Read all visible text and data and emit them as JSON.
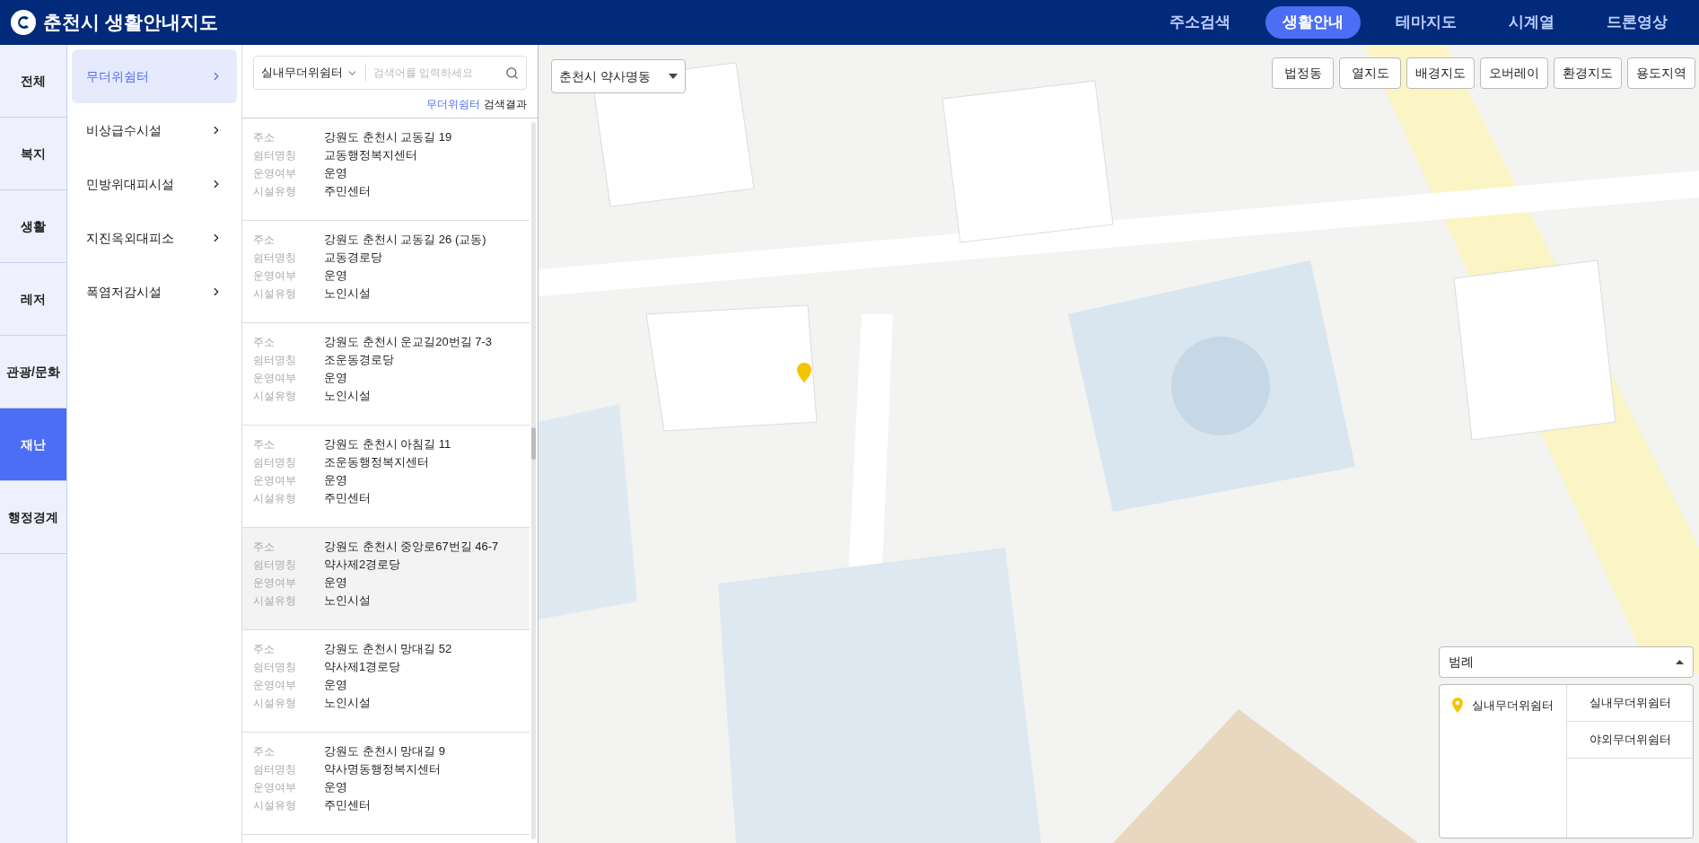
{
  "header": {
    "title": "춘천시 생활안내지도",
    "nav": [
      {
        "label": "주소검색",
        "selected": false
      },
      {
        "label": "생활안내",
        "selected": true
      },
      {
        "label": "테마지도",
        "selected": false
      },
      {
        "label": "시계열",
        "selected": false
      },
      {
        "label": "드론영상",
        "selected": false
      }
    ]
  },
  "categories": [
    {
      "label": "전체",
      "selected": false
    },
    {
      "label": "복지",
      "selected": false
    },
    {
      "label": "생활",
      "selected": false
    },
    {
      "label": "레저",
      "selected": false
    },
    {
      "label": "관광/문화",
      "selected": false
    },
    {
      "label": "재난",
      "selected": true
    },
    {
      "label": "행정경계",
      "selected": false
    }
  ],
  "subcategories": [
    {
      "label": "무더위쉼터",
      "selected": true
    },
    {
      "label": "비상급수시설",
      "selected": false
    },
    {
      "label": "민방위대피시설",
      "selected": false
    },
    {
      "label": "지진옥외대피소",
      "selected": false
    },
    {
      "label": "폭염저감시설",
      "selected": false
    }
  ],
  "search": {
    "filter": "실내무더위쉼터",
    "placeholder": "검색어를 입력하세요",
    "result_keyword": "무더위쉼터",
    "result_suffix": "검색결과"
  },
  "results": [
    {
      "selected": false,
      "fields": [
        {
          "label": "주소",
          "value": "강원도 춘천시 교동길 19"
        },
        {
          "label": "쉼터명칭",
          "value": "교동행정복지센터"
        },
        {
          "label": "운영여부",
          "value": "운영"
        },
        {
          "label": "시설유형",
          "value": "주민센터"
        }
      ]
    },
    {
      "selected": false,
      "fields": [
        {
          "label": "주소",
          "value": "강원도 춘천시 교동길 26 (교동)"
        },
        {
          "label": "쉼터명칭",
          "value": "교동경로당"
        },
        {
          "label": "운영여부",
          "value": "운영"
        },
        {
          "label": "시설유형",
          "value": "노인시설"
        }
      ]
    },
    {
      "selected": false,
      "fields": [
        {
          "label": "주소",
          "value": "강원도 춘천시 운교길20번길 7-3"
        },
        {
          "label": "쉼터명칭",
          "value": "조운동경로당"
        },
        {
          "label": "운영여부",
          "value": "운영"
        },
        {
          "label": "시설유형",
          "value": "노인시설"
        }
      ]
    },
    {
      "selected": false,
      "fields": [
        {
          "label": "주소",
          "value": "강원도 춘천시 아침길 11"
        },
        {
          "label": "쉼터명칭",
          "value": "조운동행정복지센터"
        },
        {
          "label": "운영여부",
          "value": "운영"
        },
        {
          "label": "시설유형",
          "value": "주민센터"
        }
      ]
    },
    {
      "selected": true,
      "fields": [
        {
          "label": "주소",
          "value": "강원도 춘천시 중앙로67번길 46-7"
        },
        {
          "label": "쉼터명칭",
          "value": "약사제2경로당"
        },
        {
          "label": "운영여부",
          "value": "운영"
        },
        {
          "label": "시설유형",
          "value": "노인시설"
        }
      ]
    },
    {
      "selected": false,
      "fields": [
        {
          "label": "주소",
          "value": "강원도 춘천시 망대길 52"
        },
        {
          "label": "쉼터명칭",
          "value": "약사제1경로당"
        },
        {
          "label": "운영여부",
          "value": "운영"
        },
        {
          "label": "시설유형",
          "value": "노인시설"
        }
      ]
    },
    {
      "selected": false,
      "fields": [
        {
          "label": "주소",
          "value": "강원도 춘천시 망대길 9"
        },
        {
          "label": "쉼터명칭",
          "value": "약사명동행정복지센터"
        },
        {
          "label": "운영여부",
          "value": "운영"
        },
        {
          "label": "시설유형",
          "value": "주민센터"
        }
      ]
    }
  ],
  "map": {
    "kind": "picture",
    "region_select": "춘천시 약사명동",
    "layer_buttons": [
      "법정동",
      "열지도",
      "배경지도",
      "오버레이",
      "환경지도",
      "용도지역"
    ],
    "legend": {
      "title": "범례",
      "expanded": true,
      "items": [
        {
          "label": "실내무더위쉼터"
        }
      ],
      "options": [
        {
          "label": "실내무더위쉼터"
        },
        {
          "label": "야외무더위쉼터"
        }
      ]
    }
  }
}
